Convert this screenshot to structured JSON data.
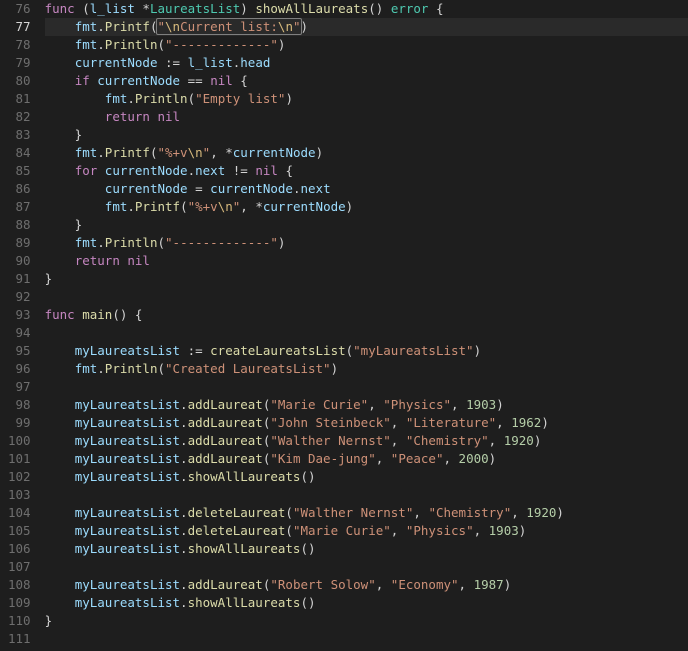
{
  "first_line_no": 76,
  "active_line_index": 1,
  "lines": [
    [
      {
        "cls": "kw",
        "t": "func"
      },
      {
        "cls": "op",
        "t": " ("
      },
      {
        "cls": "pkg",
        "t": "l_list"
      },
      {
        "cls": "op",
        "t": " *"
      },
      {
        "cls": "type",
        "t": "LaureatsList"
      },
      {
        "cls": "op",
        "t": ") "
      },
      {
        "cls": "fn",
        "t": "showAllLaureats"
      },
      {
        "cls": "op",
        "t": "() "
      },
      {
        "cls": "type",
        "t": "error"
      },
      {
        "cls": "op",
        "t": " {"
      }
    ],
    [
      {
        "cls": "op",
        "t": "    "
      },
      {
        "cls": "pkg",
        "t": "fmt"
      },
      {
        "cls": "op",
        "t": "."
      },
      {
        "cls": "fn",
        "t": "Printf"
      },
      {
        "cls": "op",
        "t": "("
      },
      {
        "cls": "op sel-start",
        "t": ""
      },
      {
        "cls": "str",
        "t": "\""
      },
      {
        "cls": "esc",
        "t": "\\n"
      },
      {
        "cls": "str",
        "t": "Current list:"
      },
      {
        "cls": "esc",
        "t": "\\n"
      },
      {
        "cls": "str",
        "t": "\""
      },
      {
        "cls": "op sel-end",
        "t": ""
      },
      {
        "cls": "op",
        "t": ")"
      }
    ],
    [
      {
        "cls": "op",
        "t": "    "
      },
      {
        "cls": "pkg",
        "t": "fmt"
      },
      {
        "cls": "op",
        "t": "."
      },
      {
        "cls": "fn",
        "t": "Println"
      },
      {
        "cls": "op",
        "t": "("
      },
      {
        "cls": "str",
        "t": "\"-------------\""
      },
      {
        "cls": "op",
        "t": ")"
      }
    ],
    [
      {
        "cls": "op",
        "t": "    "
      },
      {
        "cls": "pkg",
        "t": "currentNode"
      },
      {
        "cls": "op",
        "t": " := "
      },
      {
        "cls": "pkg",
        "t": "l_list"
      },
      {
        "cls": "op",
        "t": "."
      },
      {
        "cls": "pkg",
        "t": "head"
      }
    ],
    [
      {
        "cls": "op",
        "t": "    "
      },
      {
        "cls": "kw",
        "t": "if"
      },
      {
        "cls": "op",
        "t": " "
      },
      {
        "cls": "pkg",
        "t": "currentNode"
      },
      {
        "cls": "op",
        "t": " == "
      },
      {
        "cls": "ctrl",
        "t": "nil"
      },
      {
        "cls": "op",
        "t": " {"
      }
    ],
    [
      {
        "cls": "op",
        "t": "        "
      },
      {
        "cls": "pkg",
        "t": "fmt"
      },
      {
        "cls": "op",
        "t": "."
      },
      {
        "cls": "fn",
        "t": "Println"
      },
      {
        "cls": "op",
        "t": "("
      },
      {
        "cls": "str",
        "t": "\"Empty list\""
      },
      {
        "cls": "op",
        "t": ")"
      }
    ],
    [
      {
        "cls": "op",
        "t": "        "
      },
      {
        "cls": "kw",
        "t": "return"
      },
      {
        "cls": "op",
        "t": " "
      },
      {
        "cls": "ctrl",
        "t": "nil"
      }
    ],
    [
      {
        "cls": "op",
        "t": "    }"
      }
    ],
    [
      {
        "cls": "op",
        "t": "    "
      },
      {
        "cls": "pkg",
        "t": "fmt"
      },
      {
        "cls": "op",
        "t": "."
      },
      {
        "cls": "fn",
        "t": "Printf"
      },
      {
        "cls": "op",
        "t": "("
      },
      {
        "cls": "str",
        "t": "\"%+v"
      },
      {
        "cls": "esc",
        "t": "\\n"
      },
      {
        "cls": "str",
        "t": "\""
      },
      {
        "cls": "op",
        "t": ", *"
      },
      {
        "cls": "pkg",
        "t": "currentNode"
      },
      {
        "cls": "op",
        "t": ")"
      }
    ],
    [
      {
        "cls": "op",
        "t": "    "
      },
      {
        "cls": "kw",
        "t": "for"
      },
      {
        "cls": "op",
        "t": " "
      },
      {
        "cls": "pkg",
        "t": "currentNode"
      },
      {
        "cls": "op",
        "t": "."
      },
      {
        "cls": "pkg",
        "t": "next"
      },
      {
        "cls": "op",
        "t": " != "
      },
      {
        "cls": "ctrl",
        "t": "nil"
      },
      {
        "cls": "op",
        "t": " {"
      }
    ],
    [
      {
        "cls": "op",
        "t": "        "
      },
      {
        "cls": "pkg",
        "t": "currentNode"
      },
      {
        "cls": "op",
        "t": " = "
      },
      {
        "cls": "pkg",
        "t": "currentNode"
      },
      {
        "cls": "op",
        "t": "."
      },
      {
        "cls": "pkg",
        "t": "next"
      }
    ],
    [
      {
        "cls": "op",
        "t": "        "
      },
      {
        "cls": "pkg",
        "t": "fmt"
      },
      {
        "cls": "op",
        "t": "."
      },
      {
        "cls": "fn",
        "t": "Printf"
      },
      {
        "cls": "op",
        "t": "("
      },
      {
        "cls": "str",
        "t": "\"%+v"
      },
      {
        "cls": "esc",
        "t": "\\n"
      },
      {
        "cls": "str",
        "t": "\""
      },
      {
        "cls": "op",
        "t": ", *"
      },
      {
        "cls": "pkg",
        "t": "currentNode"
      },
      {
        "cls": "op",
        "t": ")"
      }
    ],
    [
      {
        "cls": "op",
        "t": "    }"
      }
    ],
    [
      {
        "cls": "op",
        "t": "    "
      },
      {
        "cls": "pkg",
        "t": "fmt"
      },
      {
        "cls": "op",
        "t": "."
      },
      {
        "cls": "fn",
        "t": "Println"
      },
      {
        "cls": "op",
        "t": "("
      },
      {
        "cls": "str",
        "t": "\"-------------\""
      },
      {
        "cls": "op",
        "t": ")"
      }
    ],
    [
      {
        "cls": "op",
        "t": "    "
      },
      {
        "cls": "kw",
        "t": "return"
      },
      {
        "cls": "op",
        "t": " "
      },
      {
        "cls": "ctrl",
        "t": "nil"
      }
    ],
    [
      {
        "cls": "op",
        "t": "}"
      }
    ],
    [],
    [
      {
        "cls": "kw",
        "t": "func"
      },
      {
        "cls": "op",
        "t": " "
      },
      {
        "cls": "fn",
        "t": "main"
      },
      {
        "cls": "op",
        "t": "() {"
      }
    ],
    [],
    [
      {
        "cls": "op",
        "t": "    "
      },
      {
        "cls": "pkg",
        "t": "myLaureatsList"
      },
      {
        "cls": "op",
        "t": " := "
      },
      {
        "cls": "fn",
        "t": "createLaureatsList"
      },
      {
        "cls": "op",
        "t": "("
      },
      {
        "cls": "str",
        "t": "\"myLaureatsList\""
      },
      {
        "cls": "op",
        "t": ")"
      }
    ],
    [
      {
        "cls": "op",
        "t": "    "
      },
      {
        "cls": "pkg",
        "t": "fmt"
      },
      {
        "cls": "op",
        "t": "."
      },
      {
        "cls": "fn",
        "t": "Println"
      },
      {
        "cls": "op",
        "t": "("
      },
      {
        "cls": "str",
        "t": "\"Created LaureatsList\""
      },
      {
        "cls": "op",
        "t": ")"
      }
    ],
    [],
    [
      {
        "cls": "op",
        "t": "    "
      },
      {
        "cls": "pkg",
        "t": "myLaureatsList"
      },
      {
        "cls": "op",
        "t": "."
      },
      {
        "cls": "fn",
        "t": "addLaureat"
      },
      {
        "cls": "op",
        "t": "("
      },
      {
        "cls": "str",
        "t": "\"Marie Curie\""
      },
      {
        "cls": "op",
        "t": ", "
      },
      {
        "cls": "str",
        "t": "\"Physics\""
      },
      {
        "cls": "op",
        "t": ", "
      },
      {
        "cls": "num",
        "t": "1903"
      },
      {
        "cls": "op",
        "t": ")"
      }
    ],
    [
      {
        "cls": "op",
        "t": "    "
      },
      {
        "cls": "pkg",
        "t": "myLaureatsList"
      },
      {
        "cls": "op",
        "t": "."
      },
      {
        "cls": "fn",
        "t": "addLaureat"
      },
      {
        "cls": "op",
        "t": "("
      },
      {
        "cls": "str",
        "t": "\"John Steinbeck\""
      },
      {
        "cls": "op",
        "t": ", "
      },
      {
        "cls": "str",
        "t": "\"Literature\""
      },
      {
        "cls": "op",
        "t": ", "
      },
      {
        "cls": "num",
        "t": "1962"
      },
      {
        "cls": "op",
        "t": ")"
      }
    ],
    [
      {
        "cls": "op",
        "t": "    "
      },
      {
        "cls": "pkg",
        "t": "myLaureatsList"
      },
      {
        "cls": "op",
        "t": "."
      },
      {
        "cls": "fn",
        "t": "addLaureat"
      },
      {
        "cls": "op",
        "t": "("
      },
      {
        "cls": "str",
        "t": "\"Walther Nernst\""
      },
      {
        "cls": "op",
        "t": ", "
      },
      {
        "cls": "str",
        "t": "\"Chemistry\""
      },
      {
        "cls": "op",
        "t": ", "
      },
      {
        "cls": "num",
        "t": "1920"
      },
      {
        "cls": "op",
        "t": ")"
      }
    ],
    [
      {
        "cls": "op",
        "t": "    "
      },
      {
        "cls": "pkg",
        "t": "myLaureatsList"
      },
      {
        "cls": "op",
        "t": "."
      },
      {
        "cls": "fn",
        "t": "addLaureat"
      },
      {
        "cls": "op",
        "t": "("
      },
      {
        "cls": "str",
        "t": "\"Kim Dae-jung\""
      },
      {
        "cls": "op",
        "t": ", "
      },
      {
        "cls": "str",
        "t": "\"Peace\""
      },
      {
        "cls": "op",
        "t": ", "
      },
      {
        "cls": "num",
        "t": "2000"
      },
      {
        "cls": "op",
        "t": ")"
      }
    ],
    [
      {
        "cls": "op",
        "t": "    "
      },
      {
        "cls": "pkg",
        "t": "myLaureatsList"
      },
      {
        "cls": "op",
        "t": "."
      },
      {
        "cls": "fn",
        "t": "showAllLaureats"
      },
      {
        "cls": "op",
        "t": "()"
      }
    ],
    [],
    [
      {
        "cls": "op",
        "t": "    "
      },
      {
        "cls": "pkg",
        "t": "myLaureatsList"
      },
      {
        "cls": "op",
        "t": "."
      },
      {
        "cls": "fn",
        "t": "deleteLaureat"
      },
      {
        "cls": "op",
        "t": "("
      },
      {
        "cls": "str",
        "t": "\"Walther Nernst\""
      },
      {
        "cls": "op",
        "t": ", "
      },
      {
        "cls": "str",
        "t": "\"Chemistry\""
      },
      {
        "cls": "op",
        "t": ", "
      },
      {
        "cls": "num",
        "t": "1920"
      },
      {
        "cls": "op",
        "t": ")"
      }
    ],
    [
      {
        "cls": "op",
        "t": "    "
      },
      {
        "cls": "pkg",
        "t": "myLaureatsList"
      },
      {
        "cls": "op",
        "t": "."
      },
      {
        "cls": "fn",
        "t": "deleteLaureat"
      },
      {
        "cls": "op",
        "t": "("
      },
      {
        "cls": "str",
        "t": "\"Marie Curie\""
      },
      {
        "cls": "op",
        "t": ", "
      },
      {
        "cls": "str",
        "t": "\"Physics\""
      },
      {
        "cls": "op",
        "t": ", "
      },
      {
        "cls": "num",
        "t": "1903"
      },
      {
        "cls": "op",
        "t": ")"
      }
    ],
    [
      {
        "cls": "op",
        "t": "    "
      },
      {
        "cls": "pkg",
        "t": "myLaureatsList"
      },
      {
        "cls": "op",
        "t": "."
      },
      {
        "cls": "fn",
        "t": "showAllLaureats"
      },
      {
        "cls": "op",
        "t": "()"
      }
    ],
    [],
    [
      {
        "cls": "op",
        "t": "    "
      },
      {
        "cls": "pkg",
        "t": "myLaureatsList"
      },
      {
        "cls": "op",
        "t": "."
      },
      {
        "cls": "fn",
        "t": "addLaureat"
      },
      {
        "cls": "op",
        "t": "("
      },
      {
        "cls": "str",
        "t": "\"Robert Solow\""
      },
      {
        "cls": "op",
        "t": ", "
      },
      {
        "cls": "str",
        "t": "\"Economy\""
      },
      {
        "cls": "op",
        "t": ", "
      },
      {
        "cls": "num",
        "t": "1987"
      },
      {
        "cls": "op",
        "t": ")"
      }
    ],
    [
      {
        "cls": "op",
        "t": "    "
      },
      {
        "cls": "pkg",
        "t": "myLaureatsList"
      },
      {
        "cls": "op",
        "t": "."
      },
      {
        "cls": "fn",
        "t": "showAllLaureats"
      },
      {
        "cls": "op",
        "t": "()"
      }
    ],
    [
      {
        "cls": "op",
        "t": "}"
      }
    ],
    []
  ]
}
